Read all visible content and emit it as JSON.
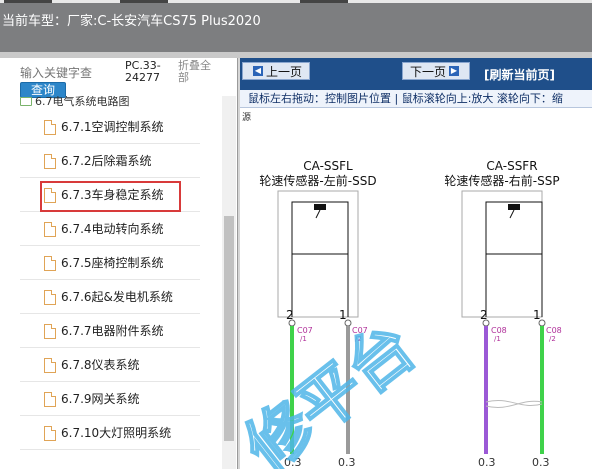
{
  "header": {
    "vehicle_label": "当前车型：",
    "vehicle_value": "厂家:C-长安汽车CS75 Plus2020"
  },
  "sidebar": {
    "search_placeholder": "输入关键字查",
    "search_button": "查询",
    "code_label": "PC.33-24277",
    "collapse_all": "折叠全部",
    "parent_item": "6.7电气系统电路图",
    "items": [
      {
        "label": "6.7.1空调控制系统"
      },
      {
        "label": "6.7.2后除霜系统"
      },
      {
        "label": "6.7.3车身稳定系统"
      },
      {
        "label": "6.7.4电动转向系统"
      },
      {
        "label": "6.7.5座椅控制系统"
      },
      {
        "label": "6.7.6起&发电机系统"
      },
      {
        "label": "6.7.7电器附件系统"
      },
      {
        "label": "6.7.8仪表系统"
      },
      {
        "label": "6.7.9网关系统"
      },
      {
        "label": "6.7.10大灯照明系统"
      }
    ],
    "selected_index": 2
  },
  "viewer": {
    "prev_page": "上一页",
    "next_page": "下一页",
    "refresh": "[刷新当前页]",
    "hint": "鼠标左右拖动：控制图片位置 | 鼠标滚轮向上:放大  滚轮向下：缩",
    "source_label": "源",
    "left_sensor": {
      "code": "CA-SSFL",
      "name": "轮速传感器-左前-SSD",
      "pin_a": "2",
      "pin_b": "1",
      "conn_a": "C07",
      "conn_a_pin": "/1",
      "conn_b": "C07",
      "conn_b_pin": "/2",
      "gauge_a": "0.3",
      "gauge_b": "0.3"
    },
    "right_sensor": {
      "code": "CA-SSFR",
      "name": "轮速传感器-右前-SSP",
      "pin_a": "2",
      "pin_b": "1",
      "conn_a": "C08",
      "conn_a_pin": "/1",
      "conn_b": "C08",
      "conn_b_pin": "/2",
      "gauge_a": "0.3",
      "gauge_b": "0.3"
    },
    "watermark": "修平台",
    "colors": {
      "wire_green": "#3fd24a",
      "wire_gray": "#9a9a9a",
      "wire_purple": "#9b59d6",
      "connector_text": "#b0309a",
      "watermark": "#4fb6e8"
    }
  }
}
